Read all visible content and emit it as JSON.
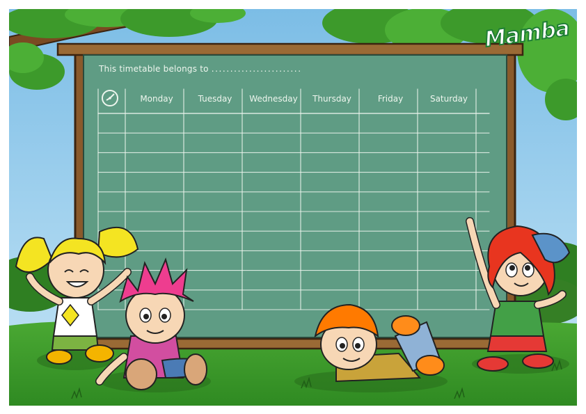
{
  "brand": {
    "logo_text": "Mamba"
  },
  "timetable": {
    "owner_label": "This timetable belongs to",
    "owner_placeholder": "........................",
    "days": [
      "Monday",
      "Tuesday",
      "Wednesday",
      "Thursday",
      "Friday",
      "Saturday"
    ],
    "row_count": 10
  },
  "colors": {
    "sky": "#86c4ea",
    "board": "#5f9c84",
    "frame": "#8a5a2b",
    "grass": "#3f9a2c",
    "leaves": "#3d9a2b",
    "chalk": "#eef6ee"
  }
}
